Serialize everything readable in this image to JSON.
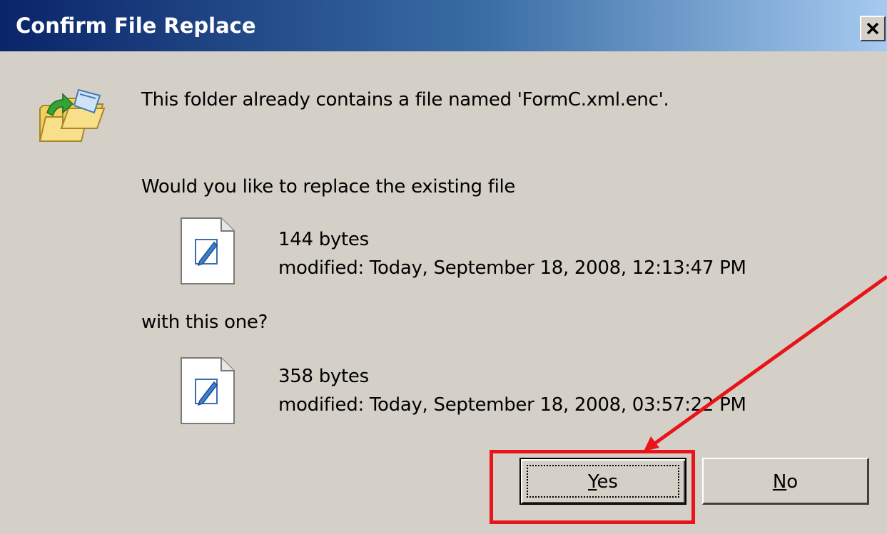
{
  "dialog": {
    "title": "Confirm File Replace",
    "close_glyph": "✕",
    "message": "This folder already contains a file named 'FormC.xml.enc'.",
    "question": "Would you like to replace the existing file",
    "existing_file": {
      "size": "144 bytes",
      "modified": "modified: Today, September 18, 2008, 12:13:47 PM",
      "icon": "document-edit-icon"
    },
    "with_text": "with this one?",
    "new_file": {
      "size": "358 bytes",
      "modified": "modified: Today, September 18, 2008, 03:57:22 PM",
      "icon": "document-edit-icon"
    },
    "header_icon": "folder-replace-icon"
  },
  "buttons": {
    "yes": {
      "mnemonic": "Y",
      "rest": "es",
      "label": "Yes"
    },
    "no": {
      "mnemonic": "N",
      "rest": "o",
      "label": "No"
    }
  },
  "annotation": {
    "color": "#e8141a",
    "type": "highlight-box-with-arrow",
    "target": "Yes"
  },
  "colors": {
    "dialog_bg": "#d4d0c8",
    "titlebar_start": "#0a246a",
    "titlebar_end": "#a6caf0"
  }
}
